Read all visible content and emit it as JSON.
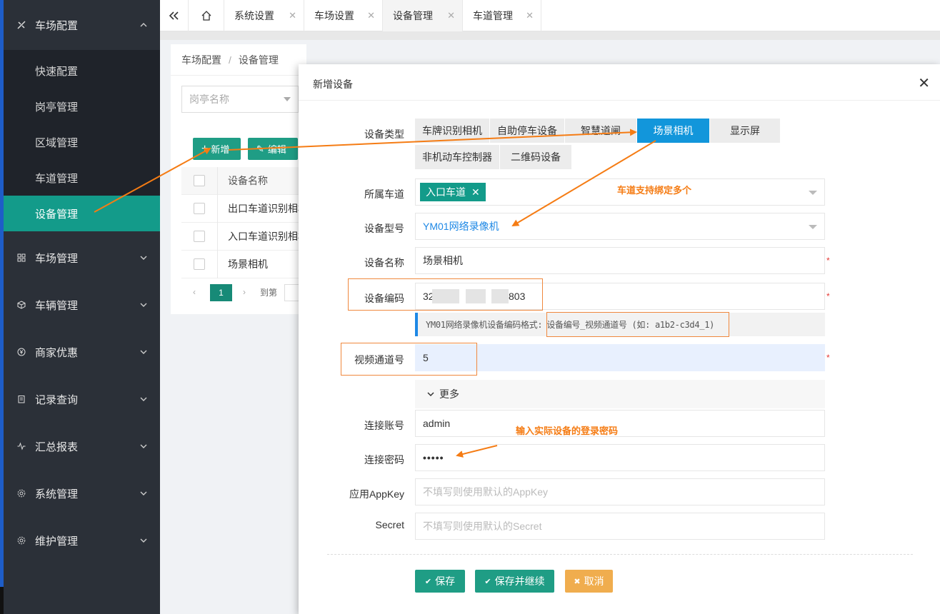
{
  "sidebar": {
    "groups": [
      {
        "label": "车场配置",
        "icon": "tools-icon",
        "expanded": true
      },
      {
        "label": "车场管理",
        "icon": "grid-icon"
      },
      {
        "label": "车辆管理",
        "icon": "cube-icon"
      },
      {
        "label": "商家优惠",
        "icon": "yen-icon"
      },
      {
        "label": "记录查询",
        "icon": "clipboard-icon"
      },
      {
        "label": "汇总报表",
        "icon": "pulse-icon"
      },
      {
        "label": "系统管理",
        "icon": "gear-icon"
      },
      {
        "label": "维护管理",
        "icon": "gear-icon"
      }
    ],
    "sub_items": [
      "快速配置",
      "岗亭管理",
      "区域管理",
      "车道管理",
      "设备管理"
    ],
    "active_sub": "设备管理"
  },
  "tabs": [
    {
      "label": "系统设置"
    },
    {
      "label": "车场设置"
    },
    {
      "label": "设备管理",
      "active": true
    },
    {
      "label": "车道管理"
    }
  ],
  "background": {
    "breadcrumb": [
      "车场配置",
      "设备管理"
    ],
    "filter_placeholder": "岗亭名称",
    "add_label": "新增",
    "edit_label": "编辑",
    "table_header": "设备名称",
    "rows": [
      "出口车道识别相机",
      "入口车道识别相机",
      "场景相机"
    ],
    "page": "1",
    "goto_label": "到第"
  },
  "modal": {
    "title": "新增设备",
    "labels": {
      "device_type": "设备类型",
      "lane": "所属车道",
      "model": "设备型号",
      "name": "设备名称",
      "code": "设备编码",
      "channel": "视频通道号",
      "account": "连接账号",
      "password": "连接密码",
      "appkey": "应用AppKey",
      "secret": "Secret"
    },
    "device_types": [
      "车牌识别相机",
      "自助停车设备",
      "智慧道闸",
      "场景相机",
      "显示屏",
      "非机动车控制器",
      "二维码设备"
    ],
    "active_type": "场景相机",
    "lane_tag": "入口车道",
    "model_value": "YM01网络录像机",
    "name_value": "场景相机",
    "code_prefix": "32",
    "code_suffix": "803",
    "hint_prefix": "YM01网络录像机设备编码格式:",
    "hint_format": "设备编号_视频通道号 (如: a1b2-c3d4_1)",
    "channel_value": "5",
    "more_label": "更多",
    "account_value": "admin",
    "password_value": "•••••",
    "appkey_placeholder": "不填写则使用默认的AppKey",
    "secret_placeholder": "不填写则使用默认的Secret",
    "required_mark": "*",
    "buttons": {
      "save": "保存",
      "save_continue": "保存并继续",
      "cancel": "取消"
    }
  },
  "annotations": {
    "lane_multi": "车道支持绑定多个",
    "password_tip": "输入实际设备的登录密码"
  },
  "colors": {
    "sidebar_bg": "#2b3038",
    "active_teal": "#139b8a",
    "active_blue": "#1296db",
    "save_green": "#1f9d85",
    "cancel_orange": "#f0ad4e",
    "annotation_orange": "#f57c14"
  }
}
